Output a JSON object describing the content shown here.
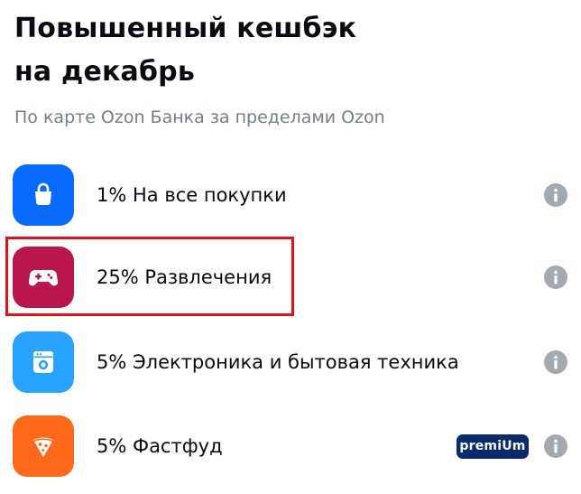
{
  "header": {
    "title_line1": "Повышенный кешбэк",
    "title_line2": "на декабрь",
    "subtitle": "По карте Ozon Банка за пределами Ozon"
  },
  "categories": [
    {
      "label": "1% На все покупки",
      "icon": "shopping-bag-icon",
      "icon_color": "#0a6cff"
    },
    {
      "label": "25% Развлечения",
      "icon": "gamepad-icon",
      "icon_color": "#b8164c"
    },
    {
      "label": "5% Электроника и бытовая техника",
      "icon": "washing-machine-icon",
      "icon_color": "#27a2ff"
    },
    {
      "label": "5% Фастфуд",
      "icon": "pizza-icon",
      "icon_color": "#ff6a1a",
      "badge": "premiUm"
    }
  ],
  "colors": {
    "info_button": "#a2a9b0",
    "highlight_border": "#e0131d",
    "premium_badge": "#0a2a6b"
  }
}
